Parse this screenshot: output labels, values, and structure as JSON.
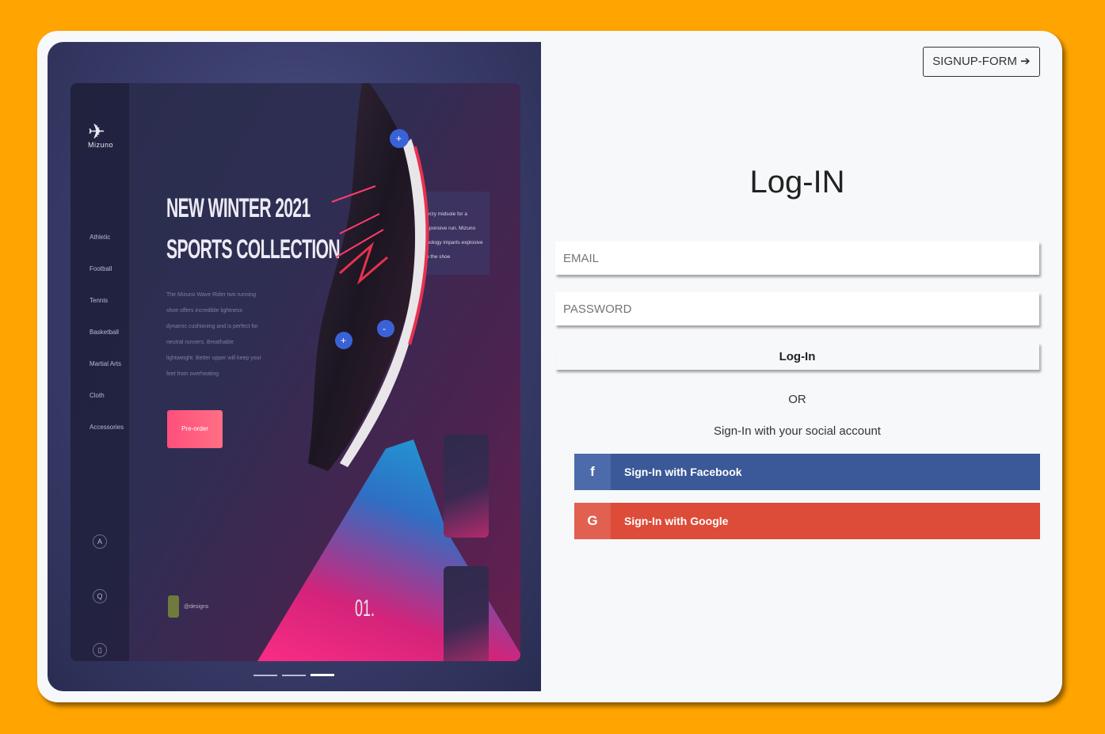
{
  "hero": {
    "brand": "Mizuno",
    "categories": [
      "Athletic",
      "Football",
      "Tennis",
      "Basketball",
      "Martial Arts",
      "Cloth",
      "Accessories"
    ],
    "headline_line1": "NEW WINTER 2021",
    "headline_line2": "SPORTS COLLECTION",
    "blurb": "The Mizuno Wave Rider two running shoe offers incredible lightness dynamic cushioning and is perfect for neutral runners. Breathable lightweight. Better upper will keep your feet from overheating",
    "preorder_label": "Pre-order",
    "info_text": "Mizuno Enerzy midsole for a smooth, responsive run. Mizuno Wave technology imparts explosive repulsion to the shoe",
    "author": "@designs",
    "slide_number": "01.",
    "active_slide": 3,
    "total_slides": 3
  },
  "header": {
    "signup_label": "SIGNUP-FORM ➔"
  },
  "form": {
    "title": "Log-IN",
    "email_placeholder": "EMAIL",
    "password_placeholder": "PASSWORD",
    "login_label": "Log-In",
    "or_label": "OR",
    "social_text": "Sign-In with your social account",
    "facebook_label": "Sign-In with Facebook",
    "facebook_icon": "f",
    "google_label": "Sign-In with Google",
    "google_icon": "G"
  },
  "colors": {
    "background": "#ffa400",
    "facebook": "#3b5998",
    "google": "#dd4b39"
  }
}
